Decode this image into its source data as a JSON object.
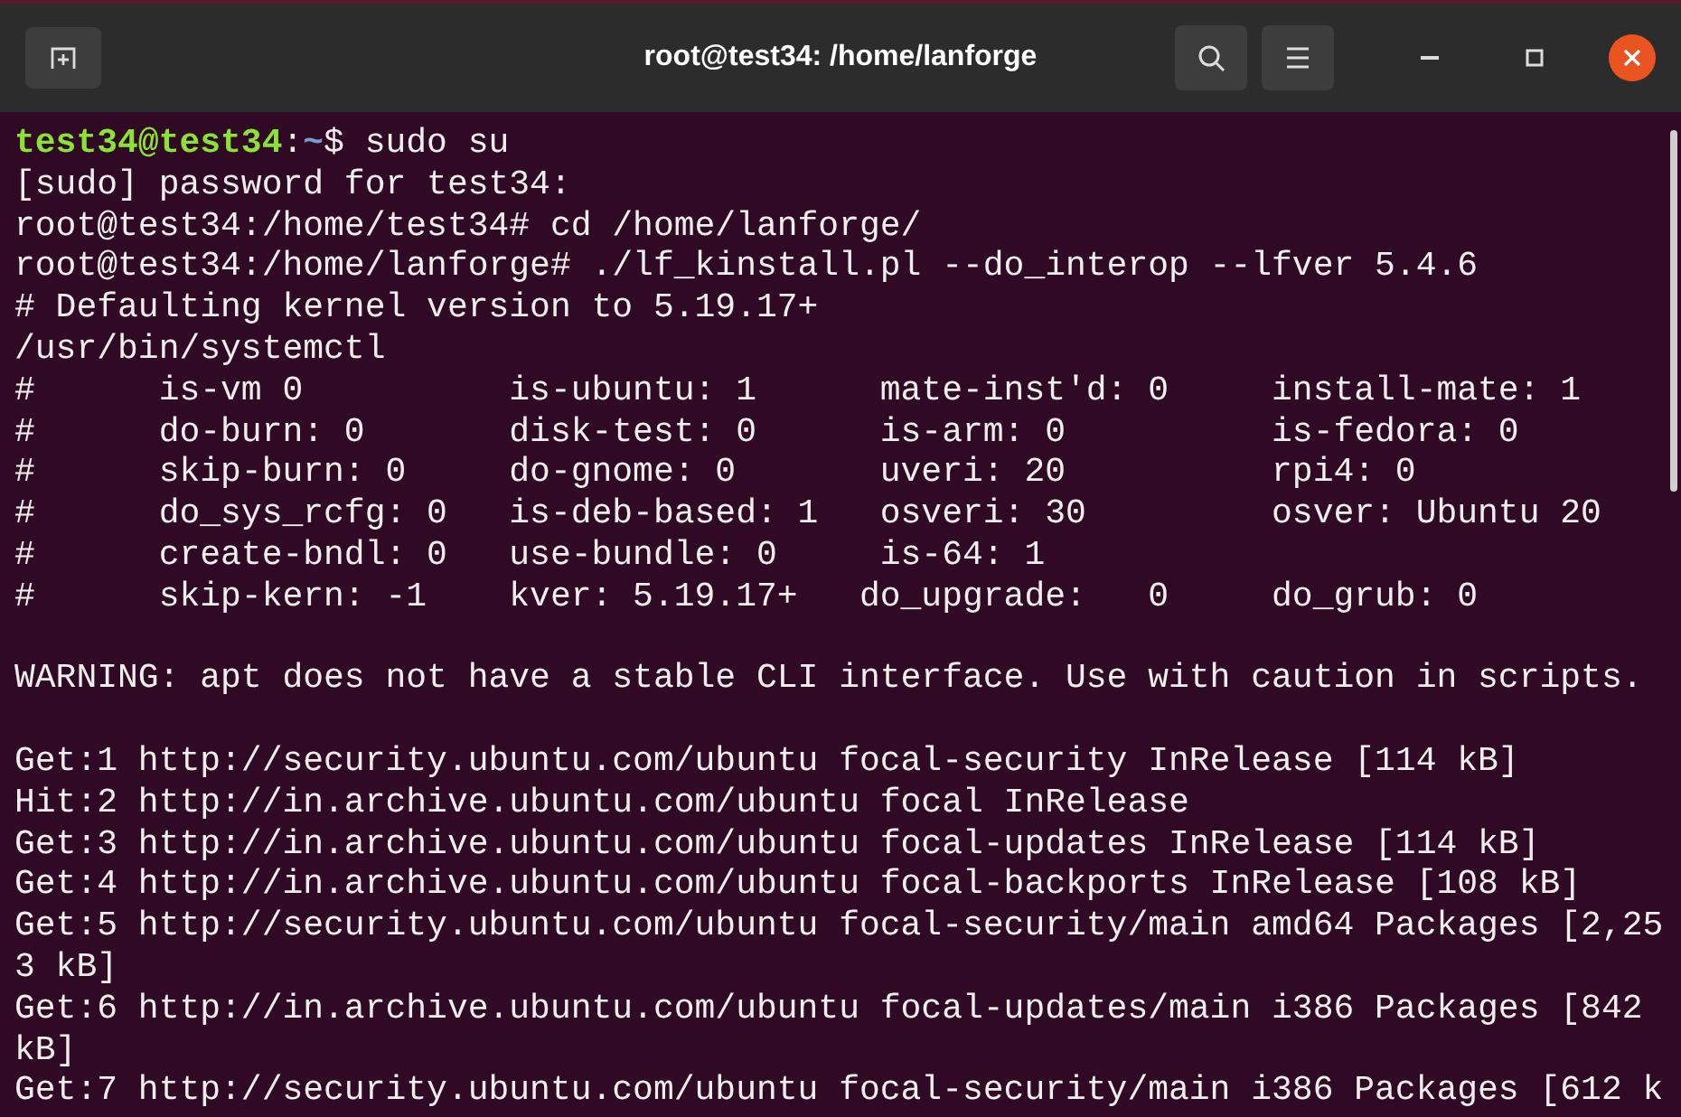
{
  "window": {
    "title": "root@test34: /home/lanforge"
  },
  "terminal": {
    "lines": [
      {
        "kind": "prompt",
        "user_host": "test34@test34",
        "separator": ":",
        "path": "~",
        "command": "$ sudo su"
      },
      {
        "kind": "output",
        "text": "[sudo] password for test34:"
      },
      {
        "kind": "output",
        "text": "root@test34:/home/test34# cd /home/lanforge/"
      },
      {
        "kind": "output",
        "text": "root@test34:/home/lanforge# ./lf_kinstall.pl --do_interop --lfver 5.4.6"
      },
      {
        "kind": "output",
        "text": "# Defaulting kernel version to 5.19.17+"
      },
      {
        "kind": "output",
        "text": "/usr/bin/systemctl"
      },
      {
        "kind": "output",
        "text": "#      is-vm 0          is-ubuntu: 1      mate-inst'd: 0     install-mate: 1"
      },
      {
        "kind": "output",
        "text": "#      do-burn: 0       disk-test: 0      is-arm: 0          is-fedora: 0"
      },
      {
        "kind": "output",
        "text": "#      skip-burn: 0     do-gnome: 0       uveri: 20          rpi4: 0"
      },
      {
        "kind": "output",
        "text": "#      do_sys_rcfg: 0   is-deb-based: 1   osveri: 30         osver: Ubuntu 20"
      },
      {
        "kind": "output",
        "text": "#      create-bndl: 0   use-bundle: 0     is-64: 1"
      },
      {
        "kind": "output",
        "text": "#      skip-kern: -1    kver: 5.19.17+   do_upgrade:   0     do_grub: 0"
      },
      {
        "kind": "blank"
      },
      {
        "kind": "output",
        "text": "WARNING: apt does not have a stable CLI interface. Use with caution in scripts."
      },
      {
        "kind": "blank"
      },
      {
        "kind": "output",
        "text": "Get:1 http://security.ubuntu.com/ubuntu focal-security InRelease [114 kB]"
      },
      {
        "kind": "output",
        "text": "Hit:2 http://in.archive.ubuntu.com/ubuntu focal InRelease"
      },
      {
        "kind": "output",
        "text": "Get:3 http://in.archive.ubuntu.com/ubuntu focal-updates InRelease [114 kB]"
      },
      {
        "kind": "output",
        "text": "Get:4 http://in.archive.ubuntu.com/ubuntu focal-backports InRelease [108 kB]"
      },
      {
        "kind": "output",
        "text": "Get:5 http://security.ubuntu.com/ubuntu focal-security/main amd64 Packages [2,25"
      },
      {
        "kind": "output",
        "text": "3 kB]"
      },
      {
        "kind": "output",
        "text": "Get:6 http://in.archive.ubuntu.com/ubuntu focal-updates/main i386 Packages [842"
      },
      {
        "kind": "output",
        "text": "kB]"
      },
      {
        "kind": "output",
        "text": "Get:7 http://security.ubuntu.com/ubuntu focal-security/main i386 Packages [612 k"
      }
    ]
  }
}
